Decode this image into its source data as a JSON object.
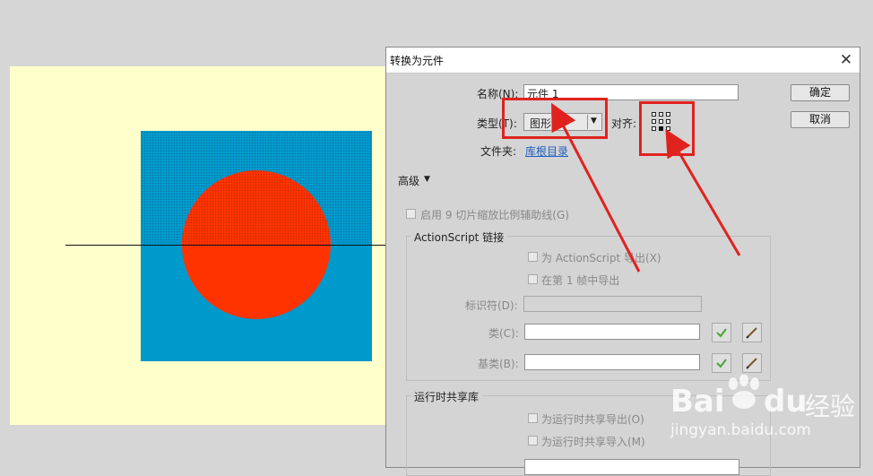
{
  "dialog": {
    "title": "转换为元件",
    "close_glyph": "✕",
    "name_label": "名称(N):",
    "name_value": "元件 1",
    "type_label": "类型(T):",
    "type_value": "图形",
    "type_arrow": "▼",
    "align_label": "对齐:",
    "folder_label": "文件夹:",
    "folder_link": "库根目录",
    "ok_label": "确定",
    "cancel_label": "取消",
    "advanced_label": "高级",
    "advanced_arrow": "▼",
    "scale9_label": "启用 9 切片缩放比例辅助线(G)",
    "as_group": {
      "title": "ActionScript 链接",
      "export_label": "为 ActionScript 导出(X)",
      "frame_export_label": "在第 1 帧中导出",
      "identifier_label": "标识符(D):",
      "class_label": "类(C):",
      "base_label": "基类(B):"
    },
    "runtime_group": {
      "title": "运行时共享库",
      "export_label": "为运行时共享导出(O)",
      "import_label": "为运行时共享导入(M)"
    }
  },
  "watermark": {
    "brand": "Bai",
    "brand2": "du",
    "brand_cn": "经验",
    "url": "jingyan.baidu.com"
  },
  "colors": {
    "stage": "#ffffcc",
    "rect": "#0099cc",
    "circle": "#ff3300",
    "annotation": "#e0221f"
  }
}
